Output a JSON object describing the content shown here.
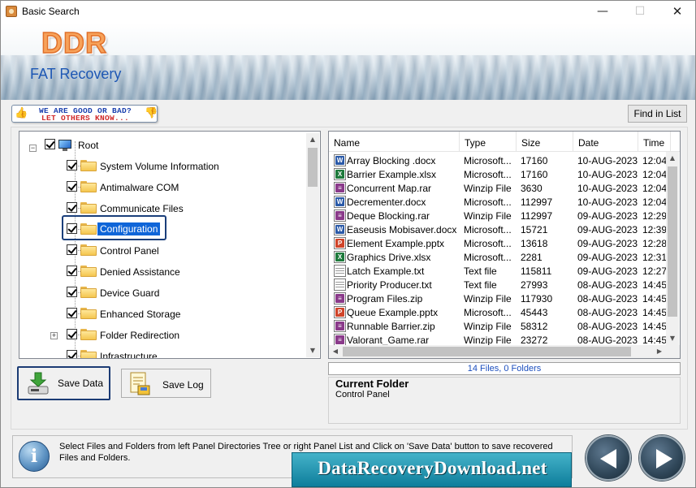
{
  "window": {
    "title": "Basic Search",
    "min_glyph": "—",
    "max_glyph": "☐",
    "close_glyph": "✕"
  },
  "header": {
    "brand": "DDR",
    "product": "FAT Recovery"
  },
  "feedback": {
    "line1": "WE ARE GOOD OR BAD?",
    "line2": "LET OTHERS KNOW...",
    "up_glyph": "👍",
    "down_glyph": "👎"
  },
  "toolbar": {
    "find_label": "Find in List"
  },
  "tree": {
    "root": "Root",
    "expander_minus": "−",
    "expander_plus": "+",
    "items": [
      {
        "label": "System Volume Information"
      },
      {
        "label": "Antimalware COM"
      },
      {
        "label": "Communicate Files"
      },
      {
        "label": "Configuration",
        "selected": true
      },
      {
        "label": "Control Panel"
      },
      {
        "label": "Denied Assistance"
      },
      {
        "label": "Device Guard"
      },
      {
        "label": "Enhanced Storage"
      },
      {
        "label": "Folder Redirection",
        "expandable": true
      },
      {
        "label": "Infrastructure"
      }
    ]
  },
  "list": {
    "columns": [
      "Name",
      "Type",
      "Size",
      "Date",
      "Time"
    ],
    "rows": [
      {
        "name": "Array Blocking .docx",
        "type": "Microsoft...",
        "size": "17160",
        "date": "10-AUG-2023",
        "time": "12:04",
        "icon": "docx"
      },
      {
        "name": "Barrier Example.xlsx",
        "type": "Microsoft...",
        "size": "17160",
        "date": "10-AUG-2023",
        "time": "12:04",
        "icon": "xlsx"
      },
      {
        "name": "Concurrent Map.rar",
        "type": "Winzip File",
        "size": "3630",
        "date": "10-AUG-2023",
        "time": "12:04",
        "icon": "rar"
      },
      {
        "name": "Decrementer.docx",
        "type": "Microsoft...",
        "size": "112997",
        "date": "10-AUG-2023",
        "time": "12:04",
        "icon": "docx"
      },
      {
        "name": "Deque Blocking.rar",
        "type": "Winzip File",
        "size": "112997",
        "date": "09-AUG-2023",
        "time": "12:29",
        "icon": "rar"
      },
      {
        "name": "Easeusis Mobisaver.docx",
        "type": "Microsoft...",
        "size": "15721",
        "date": "09-AUG-2023",
        "time": "12:39",
        "icon": "docx"
      },
      {
        "name": "Element Example.pptx",
        "type": "Microsoft...",
        "size": "13618",
        "date": "09-AUG-2023",
        "time": "12:28",
        "icon": "pptx"
      },
      {
        "name": "Graphics Drive.xlsx",
        "type": "Microsoft...",
        "size": "2281",
        "date": "09-AUG-2023",
        "time": "12:31",
        "icon": "xlsx"
      },
      {
        "name": "Latch Example.txt",
        "type": "Text file",
        "size": "115811",
        "date": "09-AUG-2023",
        "time": "12:27",
        "icon": "txt"
      },
      {
        "name": "Priority Producer.txt",
        "type": "Text file",
        "size": "27993",
        "date": "08-AUG-2023",
        "time": "14:45",
        "icon": "txt"
      },
      {
        "name": "Program Files.zip",
        "type": "Winzip File",
        "size": "117930",
        "date": "08-AUG-2023",
        "time": "14:45",
        "icon": "rar"
      },
      {
        "name": "Queue Example.pptx",
        "type": "Microsoft...",
        "size": "45443",
        "date": "08-AUG-2023",
        "time": "14:45",
        "icon": "pptx"
      },
      {
        "name": "Runnable Barrier.zip",
        "type": "Winzip File",
        "size": "58312",
        "date": "08-AUG-2023",
        "time": "14:45",
        "icon": "rar"
      },
      {
        "name": "Valorant_Game.rar",
        "type": "Winzip File",
        "size": "23272",
        "date": "08-AUG-2023",
        "time": "14:45",
        "icon": "rar"
      }
    ],
    "status": "14 Files, 0 Folders"
  },
  "current_folder": {
    "title": "Current Folder",
    "value": "Control Panel"
  },
  "buttons": {
    "save_data": "Save Data",
    "save_log": "Save Log"
  },
  "info": {
    "icon_glyph": "i",
    "text": "Select Files and Folders from left Panel Directories Tree or right Panel List and Click on 'Save Data' button to save recovered Files and Folders."
  },
  "site": {
    "text": "DataRecoveryDownload.net"
  },
  "icon_colors": {
    "docx": "#2b5aa8",
    "xlsx": "#1e7a3c",
    "rar": "#8a3a8a",
    "pptx": "#d0452a",
    "txt": "#ffffff"
  }
}
